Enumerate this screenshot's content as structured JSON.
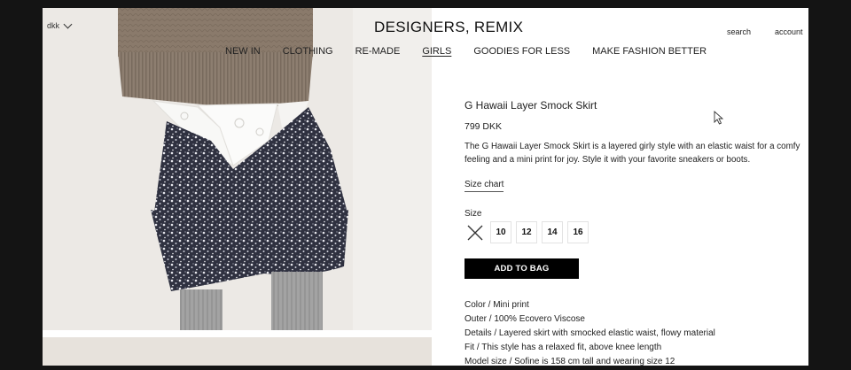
{
  "header": {
    "currency": "dkk",
    "brand": "DESIGNERS, REMIX",
    "nav": [
      "NEW IN",
      "CLOTHING",
      "RE-MADE",
      "GIRLS",
      "GOODIES FOR LESS",
      "MAKE FASHION BETTER"
    ],
    "active_nav": "GIRLS",
    "search": "search",
    "account": "account"
  },
  "product": {
    "title": "G Hawaii Layer Smock Skirt",
    "price": "799 DKK",
    "description_line1": "The G Hawaii Layer Smock Skirt is a layered girly style with an elastic waist for a comfy",
    "description_line2": "feeling and a mini print for joy. Style it with your favorite sneakers or boots.",
    "size_chart": "Size chart",
    "size_label": "Size",
    "sizes": [
      {
        "label": "",
        "available": false
      },
      {
        "label": "10",
        "available": true
      },
      {
        "label": "12",
        "available": true
      },
      {
        "label": "14",
        "available": true
      },
      {
        "label": "16",
        "available": true
      }
    ],
    "add_to_bag": "ADD TO BAG",
    "details": [
      "Color / Mini print",
      "Outer / 100% Ecovero Viscose",
      "Details / Layered skirt with smocked elastic waist, flowy material",
      "Fit / This style has a relaxed fit, above knee length",
      "Model size / Sofine is 158 cm tall and wearing size 12"
    ]
  },
  "colors": {
    "background": "#141414",
    "page": "#ffffff",
    "button": "#000000",
    "sweater": "#8a7a6b",
    "skirt": "#3a3c47"
  }
}
